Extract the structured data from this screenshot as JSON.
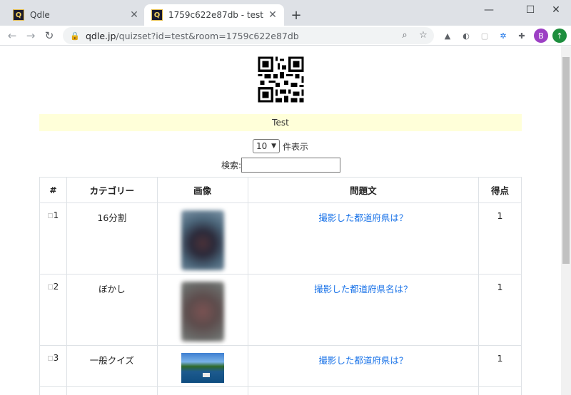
{
  "browser": {
    "tabs": [
      {
        "title": "Qdle",
        "favicon": "Q",
        "active": false
      },
      {
        "title": "1759c622e87db - test",
        "favicon": "Q",
        "active": true
      }
    ],
    "url_host": "qdle.jp",
    "url_rest": "/quizset?id=test&room=1759c622e87db",
    "avatar_letter": "B",
    "accent_colors": {
      "avatar": "#9c3fc4",
      "update": "#1e8e3e",
      "link": "#1a73e8"
    }
  },
  "page": {
    "banner_title": "Test",
    "per_page_value": "10",
    "per_page_suffix": "件表示",
    "search_label": "検索:",
    "table": {
      "headers": [
        "#",
        "カテゴリー",
        "画像",
        "問題文",
        "得点"
      ],
      "rows": [
        {
          "num": "1",
          "category": "16分割",
          "image": "blurred-photo-dark",
          "question": "撮影した都道府県は？",
          "score": "1"
        },
        {
          "num": "2",
          "category": "ぼかし",
          "image": "blurred-photo-red",
          "question": "撮影した都道府県名は？",
          "score": "1"
        },
        {
          "num": "3",
          "category": "一般クイズ",
          "image": "lake-photo",
          "question": "撮影した都道府県は？",
          "score": "1"
        }
      ]
    }
  }
}
